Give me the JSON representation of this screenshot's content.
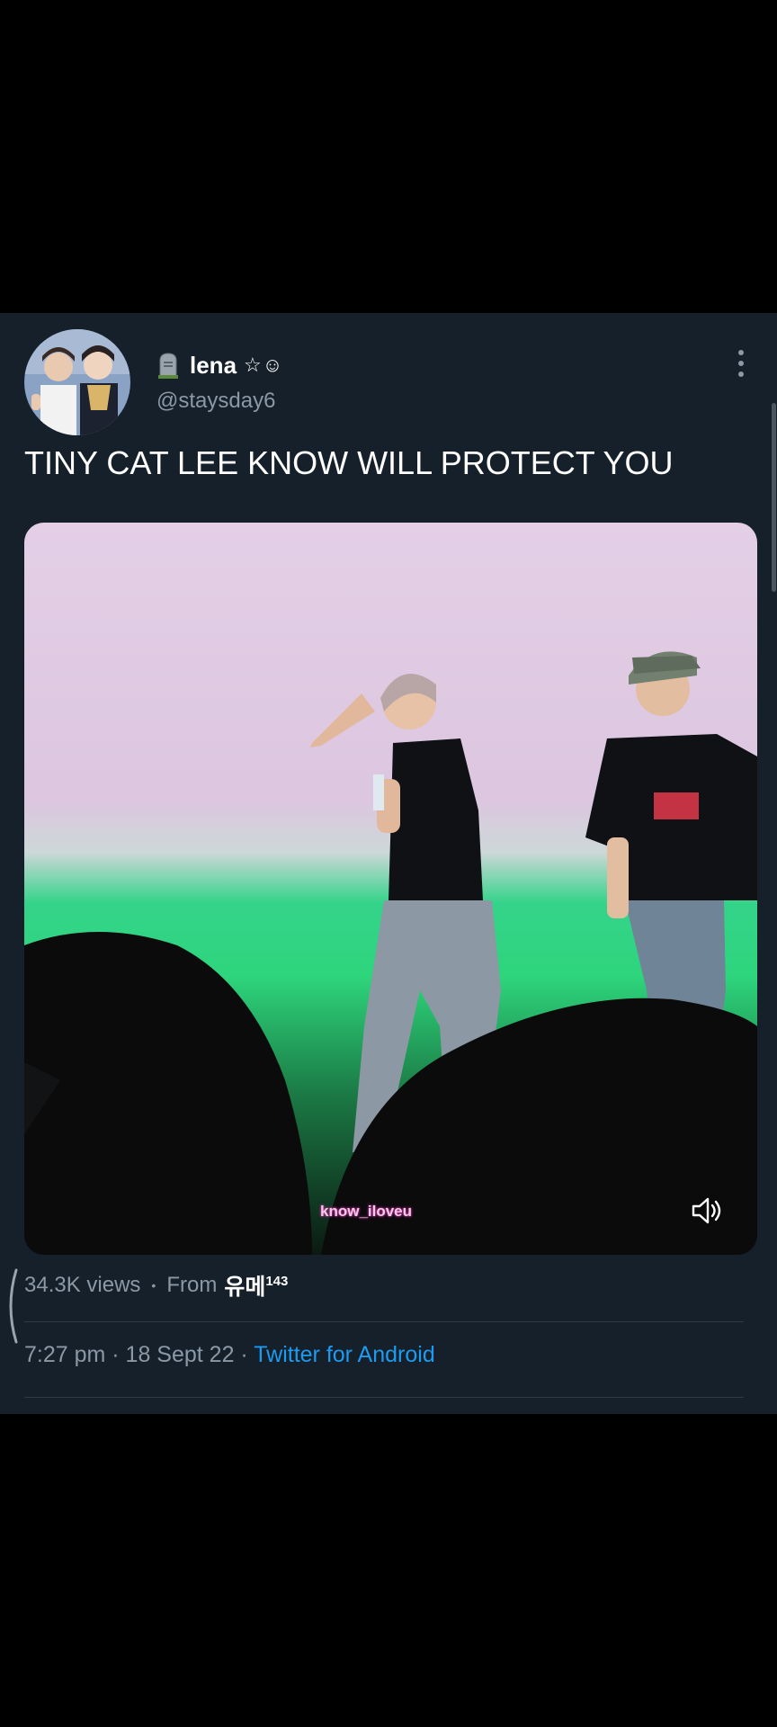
{
  "tweet": {
    "author_name": "lena",
    "author_deco": "☆☺",
    "handle": "@staysday6",
    "text": "TINY CAT LEE KNOW WILL PROTECT YOU",
    "watermark": "know_iloveu",
    "views": "34.3K views",
    "separator": "•",
    "from_label": "From",
    "from_name": "유메",
    "from_suffix": "143",
    "timestamp": "7:27 pm · 18 Sept 22 · ",
    "client": "Twitter for Android"
  },
  "colors": {
    "card_bg": "#15202b",
    "link": "#1d9bf0",
    "secondary_text": "#8b98a5"
  }
}
